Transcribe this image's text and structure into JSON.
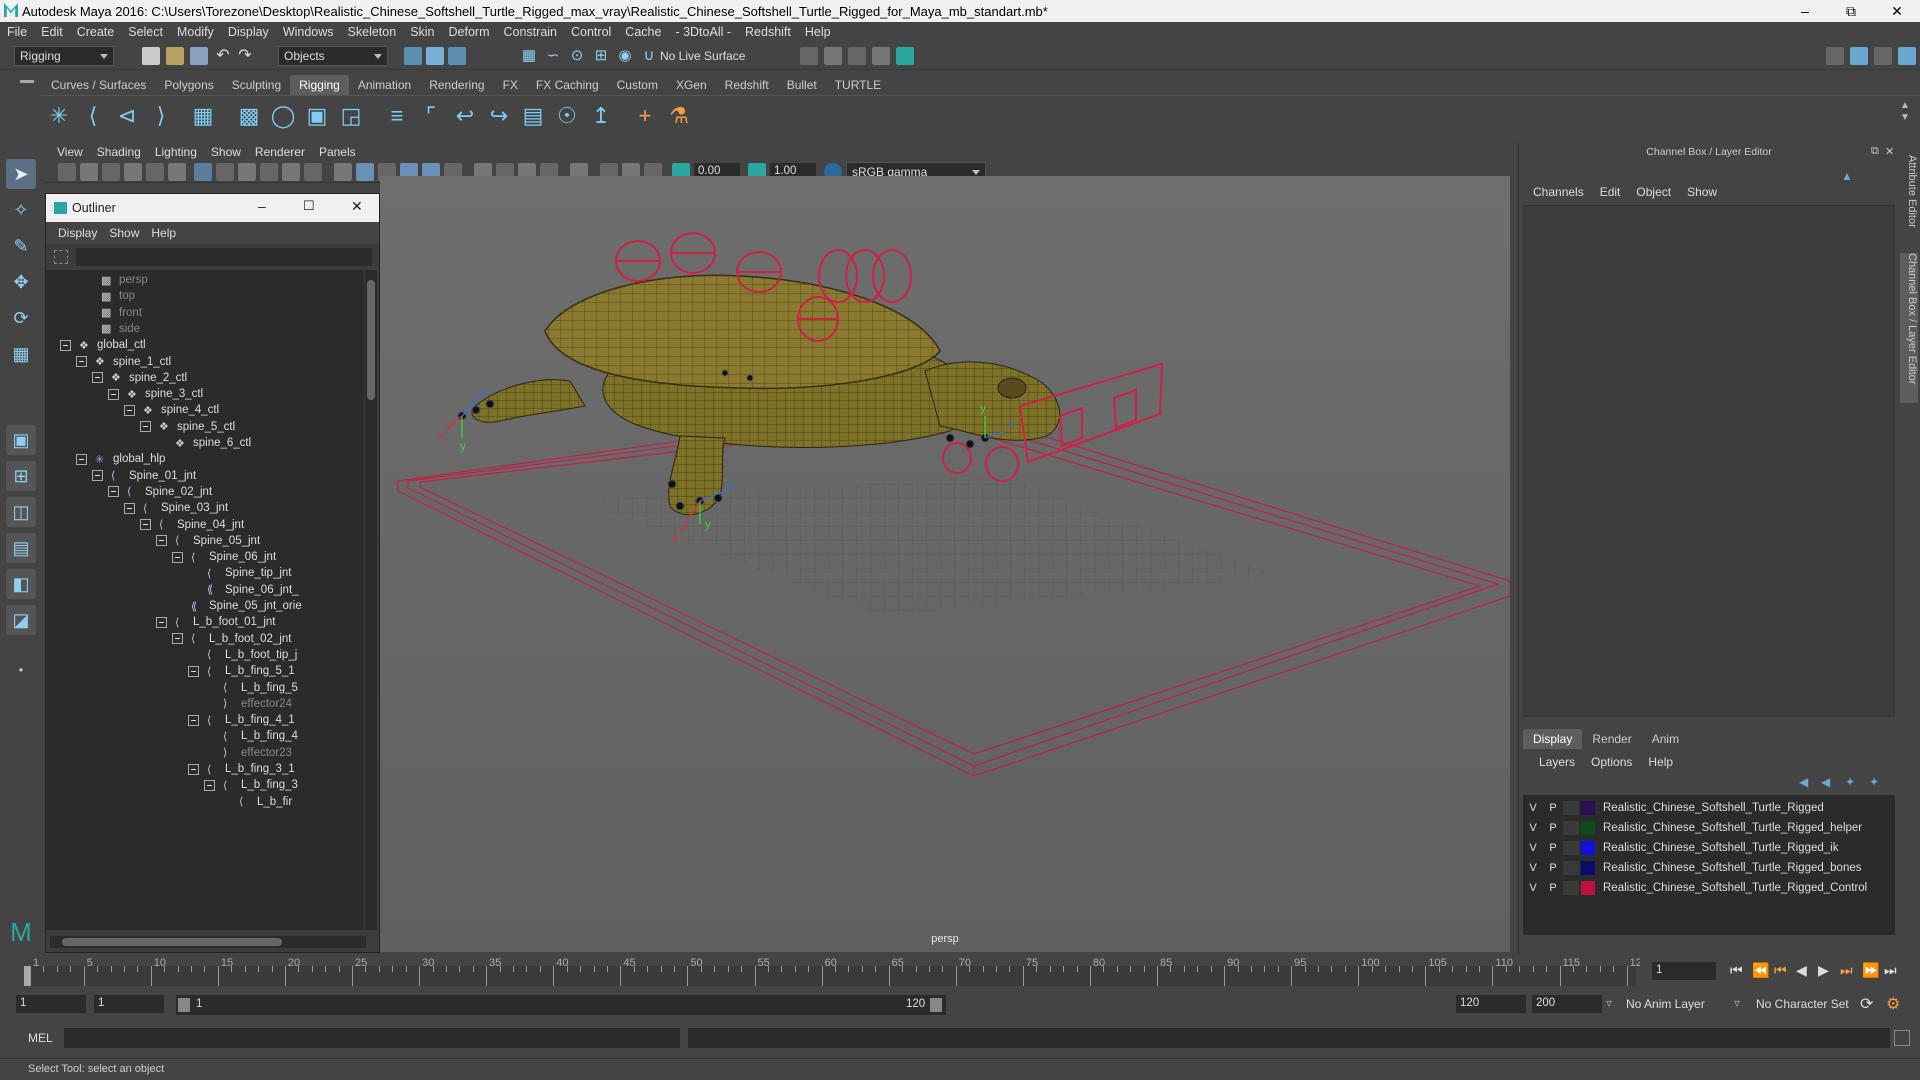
{
  "window": {
    "title": "Autodesk Maya 2016: C:\\Users\\Torezone\\Desktop\\Realistic_Chinese_Softshell_Turtle_Rigged_max_vray\\Realistic_Chinese_Softshell_Turtle_Rigged_for_Maya_mb_standart.mb*"
  },
  "menubar": [
    "File",
    "Edit",
    "Create",
    "Select",
    "Modify",
    "Display",
    "Windows",
    "Skeleton",
    "Skin",
    "Deform",
    "Constrain",
    "Control",
    "Cache",
    "- 3DtoAll -",
    "Redshift",
    "Help"
  ],
  "status": {
    "mode": "Rigging",
    "selection_mode": "Objects",
    "live_surface": "No Live Surface"
  },
  "shelf_tabs": [
    "Curves / Surfaces",
    "Polygons",
    "Sculpting",
    "Rigging",
    "Animation",
    "Rendering",
    "FX",
    "FX Caching",
    "Custom",
    "XGen",
    "Redshift",
    "Bullet",
    "TURTLE"
  ],
  "active_shelf": "Rigging",
  "viewport": {
    "menu": [
      "View",
      "Shading",
      "Lighting",
      "Show",
      "Renderer",
      "Panels"
    ],
    "field_a": "0.00",
    "field_b": "1.00",
    "color_space": "sRGB gamma",
    "camera_label": "persp"
  },
  "outliner": {
    "title": "Outliner",
    "menu": [
      "Display",
      "Show",
      "Help"
    ],
    "items": [
      {
        "label": "persp",
        "depth": 0,
        "dim": true,
        "expander": false,
        "icon": "camera-icon"
      },
      {
        "label": "top",
        "depth": 0,
        "dim": true,
        "expander": false,
        "icon": "camera-icon"
      },
      {
        "label": "front",
        "depth": 0,
        "dim": true,
        "expander": false,
        "icon": "camera-icon"
      },
      {
        "label": "side",
        "depth": 0,
        "dim": true,
        "expander": false,
        "icon": "camera-icon"
      },
      {
        "label": "global_ctl",
        "depth": 0,
        "dim": false,
        "expander": true,
        "icon": "transform-icon"
      },
      {
        "label": "spine_1_ctl",
        "depth": 1,
        "dim": false,
        "expander": true,
        "icon": "transform-icon"
      },
      {
        "label": "spine_2_ctl",
        "depth": 2,
        "dim": false,
        "expander": true,
        "icon": "transform-icon"
      },
      {
        "label": "spine_3_ctl",
        "depth": 3,
        "dim": false,
        "expander": true,
        "icon": "transform-icon"
      },
      {
        "label": "spine_4_ctl",
        "depth": 4,
        "dim": false,
        "expander": true,
        "icon": "transform-icon"
      },
      {
        "label": "spine_5_ctl",
        "depth": 5,
        "dim": false,
        "expander": true,
        "icon": "transform-icon"
      },
      {
        "label": "spine_6_ctl",
        "depth": 6,
        "dim": false,
        "expander": false,
        "icon": "transform-icon"
      },
      {
        "label": "global_hlp",
        "depth": 1,
        "dim": false,
        "expander": true,
        "icon": "locator-icon"
      },
      {
        "label": "Spine_01_jnt",
        "depth": 2,
        "dim": false,
        "expander": true,
        "icon": "joint-icon"
      },
      {
        "label": "Spine_02_jnt",
        "depth": 3,
        "dim": false,
        "expander": true,
        "icon": "joint-icon"
      },
      {
        "label": "Spine_03_jnt",
        "depth": 4,
        "dim": false,
        "expander": true,
        "icon": "joint-icon"
      },
      {
        "label": "Spine_04_jnt",
        "depth": 5,
        "dim": false,
        "expander": true,
        "icon": "joint-icon"
      },
      {
        "label": "Spine_05_jnt",
        "depth": 6,
        "dim": false,
        "expander": true,
        "icon": "joint-icon"
      },
      {
        "label": "Spine_06_jnt",
        "depth": 7,
        "dim": false,
        "expander": true,
        "icon": "joint-icon"
      },
      {
        "label": "Spine_tip_jnt",
        "depth": 8,
        "dim": false,
        "expander": false,
        "icon": "joint-icon"
      },
      {
        "label": "Spine_06_jnt_",
        "depth": 8,
        "dim": false,
        "expander": false,
        "icon": "orient-icon"
      },
      {
        "label": "Spine_05_jnt_orie",
        "depth": 7,
        "dim": false,
        "expander": false,
        "icon": "orient-icon"
      },
      {
        "label": "L_b_foot_01_jnt",
        "depth": 6,
        "dim": false,
        "expander": true,
        "icon": "joint-icon"
      },
      {
        "label": "L_b_foot_02_jnt",
        "depth": 7,
        "dim": false,
        "expander": true,
        "icon": "joint-icon"
      },
      {
        "label": "L_b_foot_tip_j",
        "depth": 8,
        "dim": false,
        "expander": false,
        "icon": "joint-icon"
      },
      {
        "label": "L_b_fing_5_1",
        "depth": 8,
        "dim": false,
        "expander": true,
        "icon": "joint-icon"
      },
      {
        "label": "L_b_fing_5",
        "depth": 9,
        "dim": false,
        "expander": false,
        "icon": "joint-icon"
      },
      {
        "label": "effector24",
        "depth": 9,
        "dim": true,
        "expander": false,
        "icon": "effector-icon"
      },
      {
        "label": "L_b_fing_4_1",
        "depth": 8,
        "dim": false,
        "expander": true,
        "icon": "joint-icon"
      },
      {
        "label": "L_b_fing_4",
        "depth": 9,
        "dim": false,
        "expander": false,
        "icon": "joint-icon"
      },
      {
        "label": "effector23",
        "depth": 9,
        "dim": true,
        "expander": false,
        "icon": "effector-icon"
      },
      {
        "label": "L_b_fing_3_1",
        "depth": 8,
        "dim": false,
        "expander": true,
        "icon": "joint-icon"
      },
      {
        "label": "L_b_fing_3",
        "depth": 9,
        "dim": false,
        "expander": true,
        "icon": "joint-icon"
      },
      {
        "label": "L_b_fir",
        "depth": 10,
        "dim": false,
        "expander": false,
        "icon": "joint-icon"
      }
    ]
  },
  "channel_box": {
    "title": "Channel Box / Layer Editor",
    "menu": [
      "Channels",
      "Edit",
      "Object",
      "Show"
    ]
  },
  "layer_editor": {
    "tabs": [
      "Display",
      "Render",
      "Anim"
    ],
    "active_tab": "Display",
    "menu": [
      "Layers",
      "Options",
      "Help"
    ],
    "layers": [
      {
        "v": "V",
        "p": "P",
        "name": "Realistic_Chinese_Softshell_Turtle_Rigged",
        "color": "#2a0f55"
      },
      {
        "v": "V",
        "p": "P",
        "name": "Realistic_Chinese_Softshell_Turtle_Rigged_helper",
        "color": "#0e4a1a"
      },
      {
        "v": "V",
        "p": "P",
        "name": "Realistic_Chinese_Softshell_Turtle_Rigged_ik",
        "color": "#1010e0"
      },
      {
        "v": "V",
        "p": "P",
        "name": "Realistic_Chinese_Softshell_Turtle_Rigged_bones",
        "color": "#0a0a70"
      },
      {
        "v": "V",
        "p": "P",
        "name": "Realistic_Chinese_Softshell_Turtle_Rigged_Control",
        "color": "#c01040"
      }
    ]
  },
  "side_tabs": [
    "Attribute Editor",
    "Channel Box / Layer Editor"
  ],
  "timeline": {
    "ticks": [
      "1",
      "5",
      "10",
      "15",
      "20",
      "25",
      "30",
      "35",
      "40",
      "45",
      "50",
      "55",
      "60",
      "65",
      "70",
      "75",
      "80",
      "85",
      "90",
      "95",
      "100",
      "105",
      "110",
      "115",
      "120"
    ],
    "current_frame": "1"
  },
  "range": {
    "start": "1",
    "playback_start": "1",
    "slider_start": "1",
    "slider_end": "120",
    "playback_end": "120",
    "end": "200",
    "anim_layer": "No Anim Layer",
    "character_set": "No Character Set"
  },
  "command": {
    "label": "MEL"
  },
  "help_line": "Select Tool: select an object",
  "viewport_labels": {
    "axis_x": "x",
    "axis_y": "y",
    "axis_z": "z"
  }
}
